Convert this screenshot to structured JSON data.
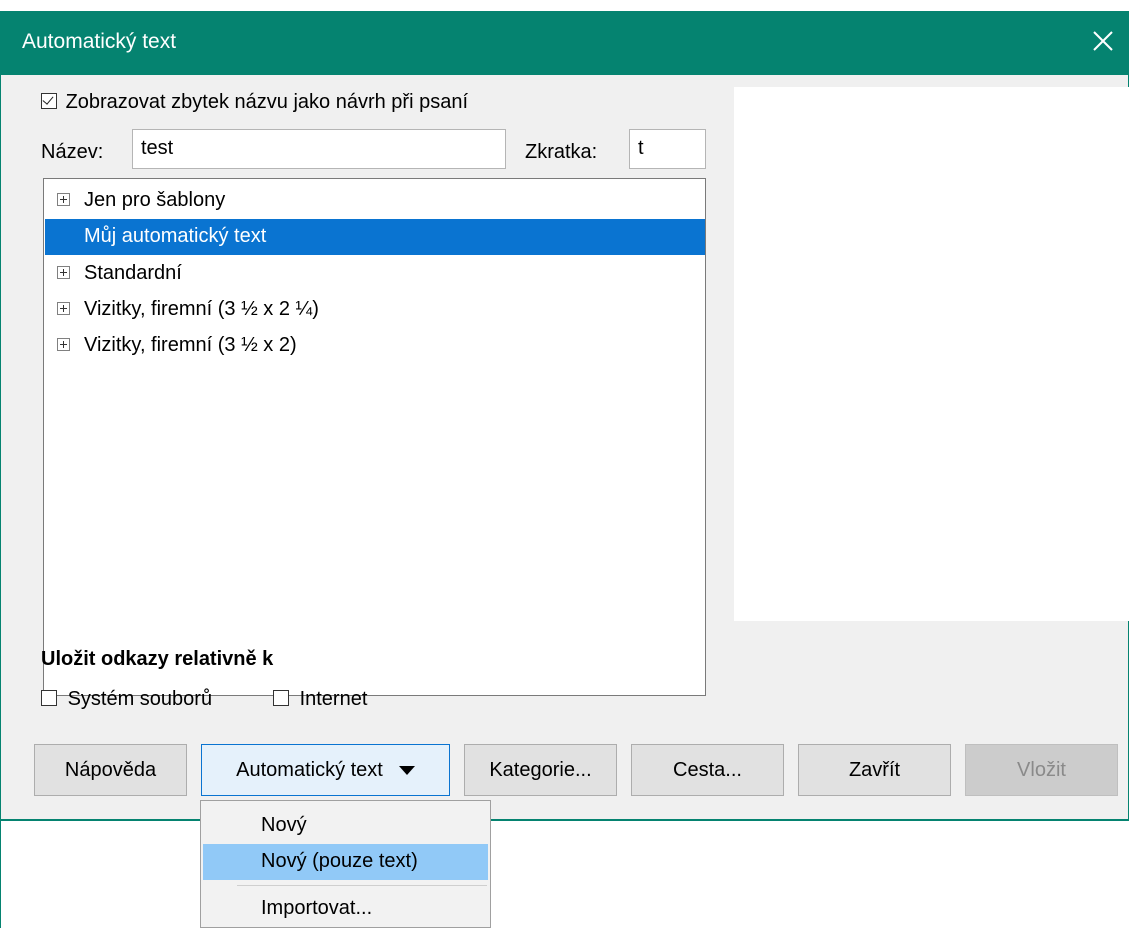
{
  "window": {
    "title": "Automatický text"
  },
  "options": {
    "suggest_label": "Zobrazovat zbytek názvu jako návrh při psaní",
    "suggest_checked": true,
    "name_label": "Název:",
    "name_value": "test",
    "shortcut_label": "Zkratka:",
    "shortcut_value": "t"
  },
  "tree": {
    "items": [
      {
        "label": "Jen pro šablony",
        "expandable": true,
        "selected": false
      },
      {
        "label": "Můj automatický text",
        "expandable": false,
        "selected": true
      },
      {
        "label": "Standardní",
        "expandable": true,
        "selected": false
      },
      {
        "label": "Vizitky, firemní (3 ½ x 2 ¼)",
        "expandable": true,
        "selected": false
      },
      {
        "label": "Vizitky, firemní (3 ½ x 2)",
        "expandable": true,
        "selected": false
      }
    ]
  },
  "links": {
    "heading": "Uložit odkazy relativně k",
    "filesystem_label": "Systém souborů",
    "filesystem_checked": false,
    "internet_label": "Internet",
    "internet_checked": false
  },
  "buttons": {
    "help": "Nápověda",
    "autotext": "Automatický text",
    "categories": "Kategorie...",
    "path": "Cesta...",
    "close": "Zavřít",
    "insert": "Vložit"
  },
  "menu": {
    "items": [
      {
        "label": "Nový",
        "highlighted": false
      },
      {
        "label": "Nový (pouze text)",
        "highlighted": true
      },
      {
        "label": "Importovat...",
        "highlighted": false
      }
    ]
  },
  "colors": {
    "titlebar": "#058370",
    "selection": "#0a74d1",
    "menu_highlight": "#91c9f7"
  },
  "icons": {
    "close": "close-icon",
    "expand": "expand-plus-icon",
    "dropdown": "triangle-down-icon"
  }
}
